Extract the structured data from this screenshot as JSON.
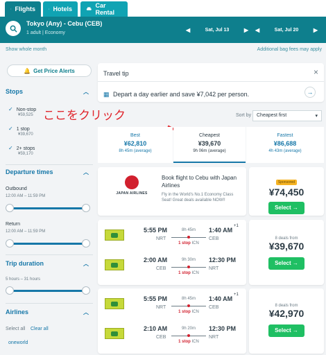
{
  "tabs": [
    {
      "label": "Flights",
      "icon": "plane-icon"
    },
    {
      "label": "Hotels",
      "icon": "bed-icon"
    },
    {
      "label": "Car Rental",
      "icon": "car-icon"
    }
  ],
  "search": {
    "route": "Tokyo (Any) - Cebu (CEB)",
    "details": "1 adult  |  Economy",
    "depart_date": "Sat, Jul 13",
    "return_date": "Sat, Jul 20"
  },
  "links": {
    "show_month": "Show whole month",
    "bag_fees": "Additional bag fees may apply"
  },
  "sidebar": {
    "alert_button": "Get Price Alerts",
    "stops_title": "Stops",
    "stops": [
      {
        "label": "Non-stop",
        "price": "¥59,525"
      },
      {
        "label": "1 stop",
        "price": "¥39,670"
      },
      {
        "label": "2+ stops",
        "price": "¥59,170"
      }
    ],
    "departure_title": "Departure times",
    "outbound_label": "Outbound",
    "outbound_range": "12:00 AM – 11:59 PM",
    "return_label": "Return",
    "return_range": "12:00 AM – 11:59 PM",
    "trip_title": "Trip duration",
    "trip_range": "5 hours – 31 hours",
    "airlines_title": "Airlines",
    "select_all": "Select all",
    "clear_all": "Clear all",
    "oneworld": "oneworld"
  },
  "tip": {
    "title": "Travel tip",
    "text": "Depart a day earlier and save ¥7,042 per person."
  },
  "annotation": "ここをクリック",
  "sort": {
    "label": "Sort by",
    "selected": "Cheapest first",
    "tabs": [
      {
        "title": "Best",
        "price": "¥62,810",
        "duration": "8h 45m (average)"
      },
      {
        "title": "Cheapest",
        "price": "¥39,670",
        "duration": "9h 06m (average)"
      },
      {
        "title": "Fastest",
        "price": "¥86,688",
        "duration": "4h 43m (average)"
      }
    ]
  },
  "ad": {
    "airline": "JAPAN AIRLINES",
    "headline": "Book flight to Cebu with Japan Airlines",
    "text": "Fly in the World's No.1 Economy Class Seat! Great deals available NOW!!",
    "sponsored": "Sponsored",
    "price": "¥74,450",
    "select": "Select →"
  },
  "results": [
    {
      "legs": [
        {
          "dep_time": "5:55 PM",
          "dep_code": "NRT",
          "duration": "8h 45m",
          "stop": "1 stop",
          "via": "ICN",
          "arr_time": "1:40 AM",
          "arr_code": "CEB",
          "plus": "+1"
        },
        {
          "dep_time": "2:00 AM",
          "dep_code": "CEB",
          "duration": "9h 30m",
          "stop": "1 stop",
          "via": "ICN",
          "arr_time": "12:30 PM",
          "arr_code": "NRT",
          "plus": ""
        }
      ],
      "deals": "8 deals from",
      "price": "¥39,670",
      "select": "Select →"
    },
    {
      "legs": [
        {
          "dep_time": "5:55 PM",
          "dep_code": "NRT",
          "duration": "8h 45m",
          "stop": "1 stop",
          "via": "ICN",
          "arr_time": "1:40 AM",
          "arr_code": "CEB",
          "plus": "+1"
        },
        {
          "dep_time": "2:10 AM",
          "dep_code": "CEB",
          "duration": "9h 20m",
          "stop": "1 stop",
          "via": "ICN",
          "arr_time": "12:30 PM",
          "arr_code": "NRT",
          "plus": ""
        }
      ],
      "deals": "8 deals from",
      "price": "¥42,970",
      "select": "Select →"
    }
  ],
  "colors": {
    "brand": "#0e7f8d",
    "link": "#1677a8",
    "select": "#1fbf63",
    "annotation": "#e0242b"
  }
}
